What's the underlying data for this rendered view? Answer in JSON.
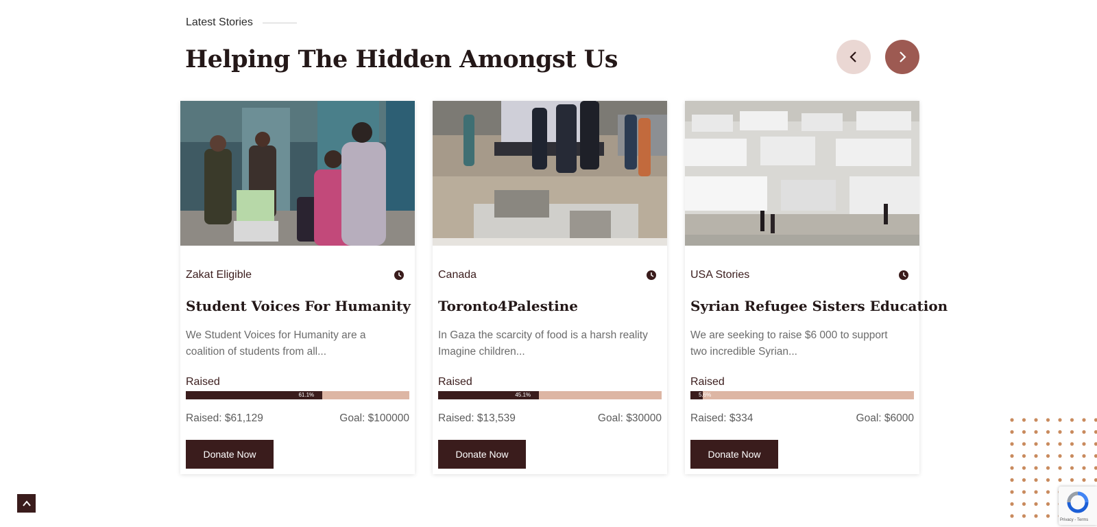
{
  "section": {
    "eyebrow": "Latest Stories",
    "title": "Helping The Hidden Amongst Us"
  },
  "nav": {
    "prev_icon": "chevron-left-icon",
    "next_icon": "chevron-right-icon"
  },
  "cards": [
    {
      "category": "Zakat Eligible",
      "title": "Student Voices For Humanity",
      "excerpt": "We Student Voices for Humanity are a coalition of students from all...",
      "raised_label": "Raised",
      "progress": 0.611,
      "progress_text": "61.1%",
      "raised": "Raised: $61,129",
      "goal": "Goal: $100000",
      "button": "Donate Now"
    },
    {
      "category": "Canada",
      "title": "Toronto4Palestine",
      "excerpt": "In Gaza the scarcity of food is a harsh reality Imagine children...",
      "raised_label": "Raised",
      "progress": 0.451,
      "progress_text": "45.1%",
      "raised": "Raised: $13,539",
      "goal": "Goal: $30000",
      "button": "Donate Now"
    },
    {
      "category": "USA Stories",
      "title": "Syrian Refugee Sisters Education",
      "excerpt": "We are seeking to raise $6 000 to support two incredible Syrian...",
      "raised_label": "Raised",
      "progress": 0.056,
      "progress_text": "5.6%",
      "raised": "Raised: $334",
      "goal": "Goal: $6000",
      "button": "Donate Now"
    }
  ],
  "recaptcha": {
    "terms": "Privacy - Terms"
  },
  "colors": {
    "brand": "#3a1c1c",
    "accent": "#9d5a52",
    "progress_track": "#ddb6a4",
    "dots": "#c98b5e"
  }
}
